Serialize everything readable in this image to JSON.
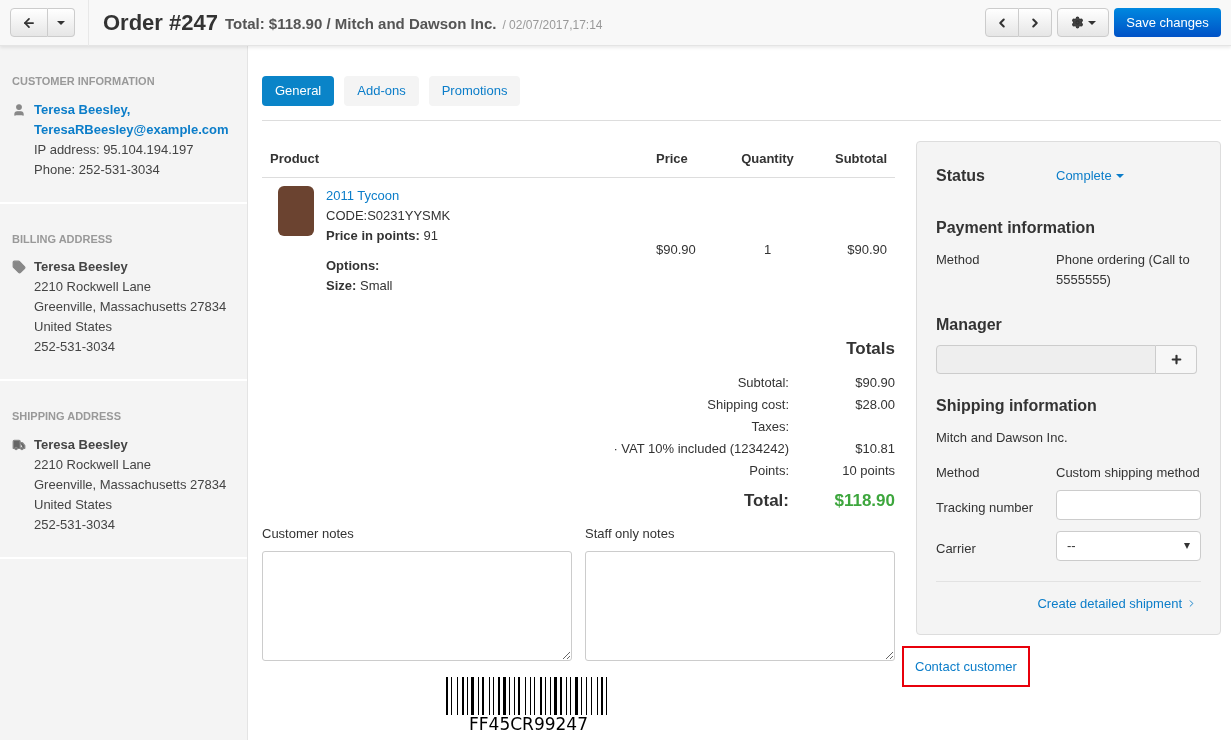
{
  "header": {
    "title": "Order #247",
    "subtitle": "Total: $118.90 / Mitch and Dawson Inc.",
    "date": "/ 02/07/2017,17:14",
    "save_button": "Save changes"
  },
  "sidebar": {
    "sections": [
      {
        "heading": "CUSTOMER INFORMATION",
        "kind": "customer",
        "lines": [
          {
            "kind": "link",
            "text": "Teresa Beesley,"
          },
          {
            "kind": "link",
            "text": "TeresaRBeesley@example.com"
          },
          {
            "kind": "text",
            "text": "IP address: 95.104.194.197"
          },
          {
            "kind": "text",
            "text": "Phone: 252-531-3034"
          }
        ]
      },
      {
        "heading": "BILLING ADDRESS",
        "kind": "billing",
        "lines": [
          {
            "kind": "bold",
            "text": "Teresa Beesley"
          },
          {
            "kind": "text",
            "text": "2210 Rockwell Lane"
          },
          {
            "kind": "text",
            "text": "Greenville, Massachusetts 27834"
          },
          {
            "kind": "text",
            "text": "United States"
          },
          {
            "kind": "text",
            "text": "252-531-3034"
          }
        ]
      },
      {
        "heading": "SHIPPING ADDRESS",
        "kind": "shipping",
        "lines": [
          {
            "kind": "bold",
            "text": "Teresa Beesley"
          },
          {
            "kind": "text",
            "text": "2210 Rockwell Lane"
          },
          {
            "kind": "text",
            "text": "Greenville, Massachusetts 27834"
          },
          {
            "kind": "text",
            "text": "United States"
          },
          {
            "kind": "text",
            "text": "252-531-3034"
          }
        ]
      }
    ]
  },
  "tabs": [
    {
      "label": "General",
      "selected": true
    },
    {
      "label": "Add-ons",
      "selected": false
    },
    {
      "label": "Promotions",
      "selected": false
    }
  ],
  "product_table": {
    "columns": [
      "Product",
      "Price",
      "Quantity",
      "Subtotal"
    ],
    "rows": [
      {
        "name": "2011 Tycoon",
        "code": "CODE:S0231YYSMK",
        "points_label": "Price in points:",
        "points_value": "91",
        "options_label": "Options:",
        "size_label": "Size:",
        "size_value": "Small",
        "price": "$90.90",
        "quantity": "1",
        "subtotal": "$90.90"
      }
    ]
  },
  "totals": {
    "heading": "Totals",
    "rows": [
      {
        "label": "Subtotal:",
        "value": "$90.90"
      },
      {
        "label": "Shipping cost:",
        "value": "$28.00"
      },
      {
        "label": "Taxes:",
        "value": ""
      },
      {
        "label": "· VAT 10% included (1234242)",
        "value": "$10.81"
      },
      {
        "label": "Points:",
        "value": "10 points"
      }
    ],
    "total_label": "Total:",
    "total_value": "$118.90"
  },
  "notes": [
    {
      "label": "Customer notes"
    },
    {
      "label": "Staff only notes"
    }
  ],
  "barcode": {
    "code": "FF45CR99247"
  },
  "panel": {
    "status_label": "Status",
    "status_value": "Complete",
    "payment_heading": "Payment information",
    "payment_method_label": "Method",
    "payment_method_value": "Phone ordering (Call to 5555555)",
    "manager_heading": "Manager",
    "shipping_heading": "Shipping information",
    "company": "Mitch and Dawson Inc.",
    "shipping_method_label": "Method",
    "shipping_method_value": "Custom shipping method",
    "tracking_label": "Tracking number",
    "carrier_label": "Carrier",
    "carrier_value": "--",
    "shipment_link": "Create detailed shipment"
  },
  "contact_link": {
    "text": "Contact customer",
    "highlighted": true
  }
}
